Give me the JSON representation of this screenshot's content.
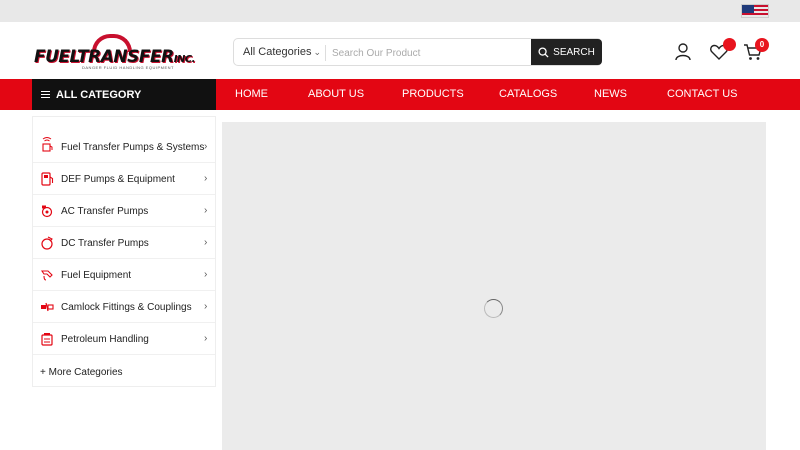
{
  "locale": {
    "flag_icon": "us-flag-icon"
  },
  "brand": {
    "logo_text": "FUELTRANSFER",
    "logo_suffix": "INC.",
    "logo_tagline": "DANGER FLUID HANDLING EQUIPMENT",
    "accent_color": "#e30613"
  },
  "search": {
    "category_label": "All Categories",
    "placeholder": "Search Our Product",
    "button_label": "SEARCH"
  },
  "header_actions": {
    "account_icon": "user-icon",
    "wishlist_icon": "heart-icon",
    "cart_icon": "cart-icon",
    "cart_count": "0"
  },
  "nav": {
    "all_category_label": "ALL CATEGORY",
    "links": [
      "HOME",
      "ABOUT US",
      "PRODUCTS",
      "CATALOGS",
      "NEWS",
      "CONTACT US"
    ]
  },
  "sidebar": {
    "items": [
      {
        "label": "Fuel Transfer Pumps & Systems",
        "icon": "fuel-pump-icon"
      },
      {
        "label": "DEF Pumps & Equipment",
        "icon": "def-pump-icon"
      },
      {
        "label": "AC Transfer Pumps",
        "icon": "ac-pump-icon"
      },
      {
        "label": "DC Transfer Pumps",
        "icon": "dc-pump-icon"
      },
      {
        "label": "Fuel Equipment",
        "icon": "fuel-nozzle-icon"
      },
      {
        "label": "Camlock Fittings & Couplings",
        "icon": "camlock-icon"
      },
      {
        "label": "Petroleum Handling",
        "icon": "petroleum-icon"
      }
    ],
    "more_label": "+ More Categories"
  },
  "banner": {
    "loading_icon": "loading-spinner-icon"
  }
}
